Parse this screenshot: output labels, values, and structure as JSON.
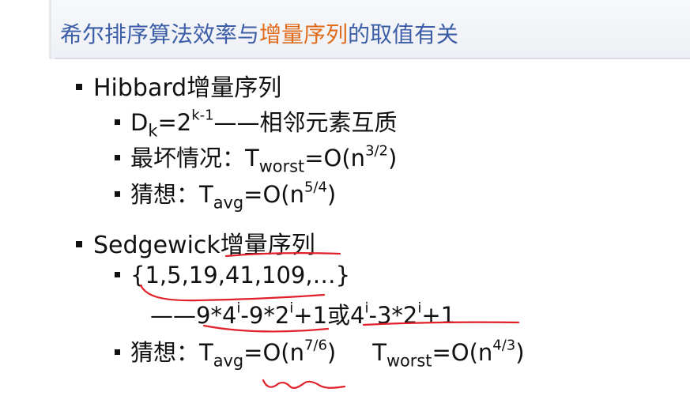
{
  "title": {
    "main": "希尔排序算法效率与",
    "highlight": "增量序列",
    "tail": "的取值有关"
  },
  "hibbard": {
    "heading": "Hibbard增量序列",
    "formula": {
      "D": "D",
      "k": "k",
      "eq": "=2",
      "exp": "k-1",
      "text": "——相邻元素互质"
    },
    "worst": {
      "label": "最坏情况：",
      "T": "T",
      "sub": "worst",
      "eq": "=O(n",
      "exp": "3/2",
      "close": ")"
    },
    "guess": {
      "label": "猜想：",
      "T": "T",
      "sub": "avg",
      "eq": "=O(n",
      "exp": "5/4",
      "close": ")"
    }
  },
  "sedgewick": {
    "heading": "Sedgewick增量序列",
    "seq": "{1,5,19,41,109,…}",
    "formula": {
      "dash": "——9*4",
      "e1": "i",
      "m1": "-9*2",
      "e2": "i",
      "m2": "+1或4",
      "e3": "i",
      "m3": "-3*2",
      "e4": "i",
      "m4": "+1"
    },
    "guess": {
      "label": "猜想：",
      "T": "T",
      "sub": "avg",
      "eq": "=O(n",
      "exp": "7/6",
      "close": ")",
      "T2": "T",
      "sub2": "worst",
      "eq2": "=O(n",
      "exp2": "4/3",
      "close2": ")"
    }
  },
  "colors": {
    "title": "#3c5ea7",
    "highlight": "#e06b1a",
    "ink": "#e0202a"
  }
}
